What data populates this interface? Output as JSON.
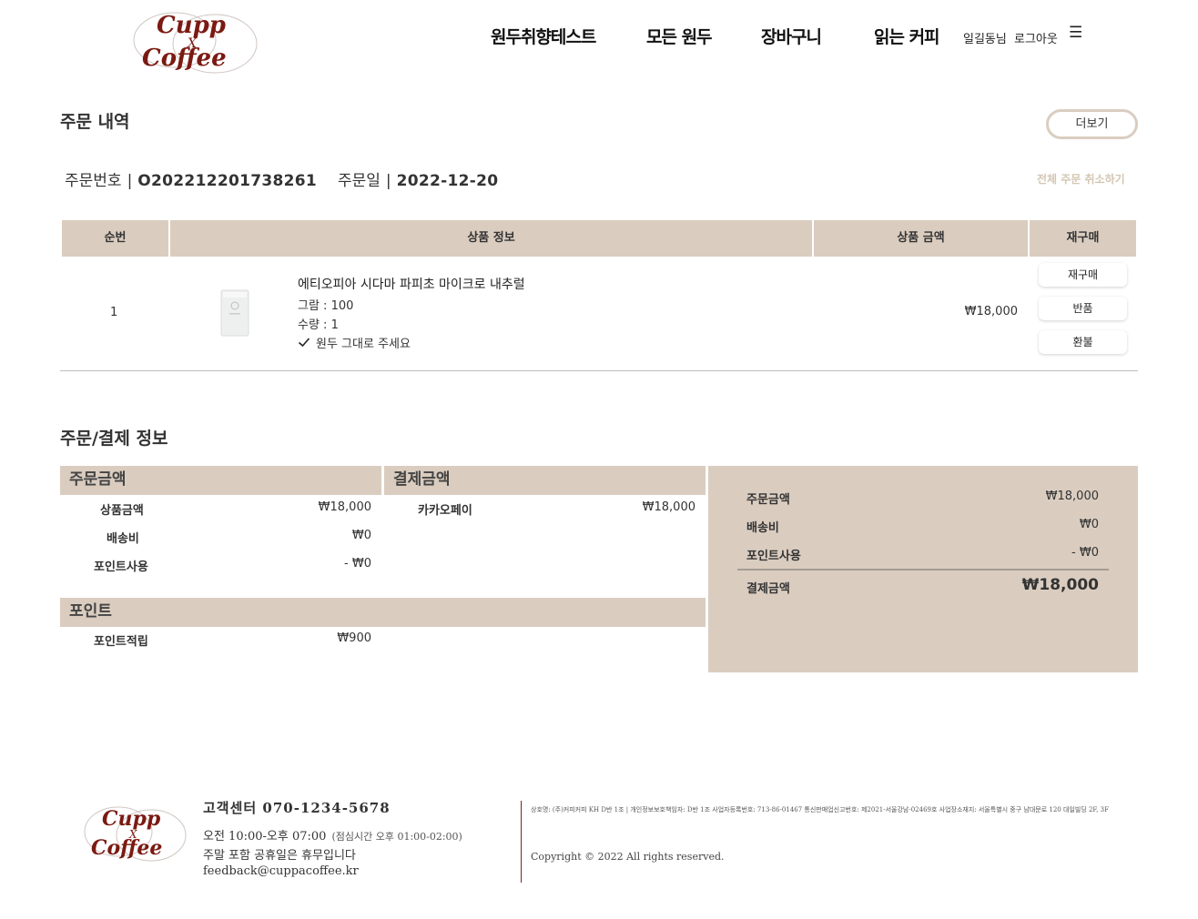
{
  "header": {
    "logo_text": [
      "Cupp",
      "X",
      "Coffee"
    ],
    "nav": [
      "원두취향테스트",
      "모든 원두",
      "장바구니",
      "읽는 커피"
    ],
    "user_name": "일길동님",
    "logout": "로그아웃",
    "menu_icon": "hamburger-menu-icon"
  },
  "order": {
    "title": "주문 내역",
    "more_button": "더보기",
    "order_no_label": "주문번호",
    "order_no": "O202212201738261",
    "order_date_label": "주문일",
    "order_date": "2022-12-20",
    "separator": "|",
    "cancel_all": "전체 주문 취소하기",
    "columns": [
      "순번",
      "상품 정보",
      "상품 금액",
      "재구매"
    ],
    "items": [
      {
        "index": "1",
        "name": "에티오피아 시다마 파피초 마이크로 내추럴",
        "weight": "그람 : 100",
        "quantity": "수량 : 1",
        "option": "원두 그대로 주세요",
        "price": "₩18,000",
        "actions": [
          "재구매",
          "반품",
          "환불"
        ]
      }
    ]
  },
  "payment": {
    "title": "주문/결제 정보",
    "order_amount": {
      "heading": "주문금액",
      "rows": [
        {
          "label": "상품금액",
          "value": "₩18,000"
        },
        {
          "label": "배송비",
          "value": "₩0"
        },
        {
          "label": "포인트사용",
          "value": "- ₩0"
        }
      ]
    },
    "paid_amount": {
      "heading": "결제금액",
      "rows": [
        {
          "label": "카카오페이",
          "value": "₩18,000"
        }
      ]
    },
    "point": {
      "heading": "포인트",
      "rows": [
        {
          "label": "포인트적립",
          "value": "₩900"
        }
      ]
    },
    "summary": {
      "rows": [
        {
          "label": "주문금액",
          "value": "₩18,000"
        },
        {
          "label": "배송비",
          "value": "₩0"
        },
        {
          "label": "포인트사용",
          "value": "- ₩0"
        }
      ],
      "total_label": "결제금액",
      "total_value": "₩18,000"
    }
  },
  "footer": {
    "logo_text": [
      "Cupp",
      "X",
      "Coffee"
    ],
    "cs_title": "고객센터 070-1234-5678",
    "hours": "오전 10:00-오후 07:00",
    "lunch": "(점심시간 오후 01:00-02:00)",
    "holiday": "주말 포함 공휴일은 휴무입니다",
    "email": "feedback@cuppacoffee.kr",
    "biz_info": "상호명: (주)커피커피 KH D반 1조 | 개인정보보호책임자: D반 1조 사업자등록번호: 713-86-01467 통신판매업신고번호: 제2021-서울강남-02469호 사업장소재지: 서울특별시 중구 남대문로 120 대일빌딩 2F, 3F",
    "copyright": "Copyright © 2022 All rights reserved."
  },
  "colors": {
    "accent_beige": "#dacdc0",
    "logo_red": "#7b1a12",
    "muted_beige_text": "#d3c6b3"
  }
}
